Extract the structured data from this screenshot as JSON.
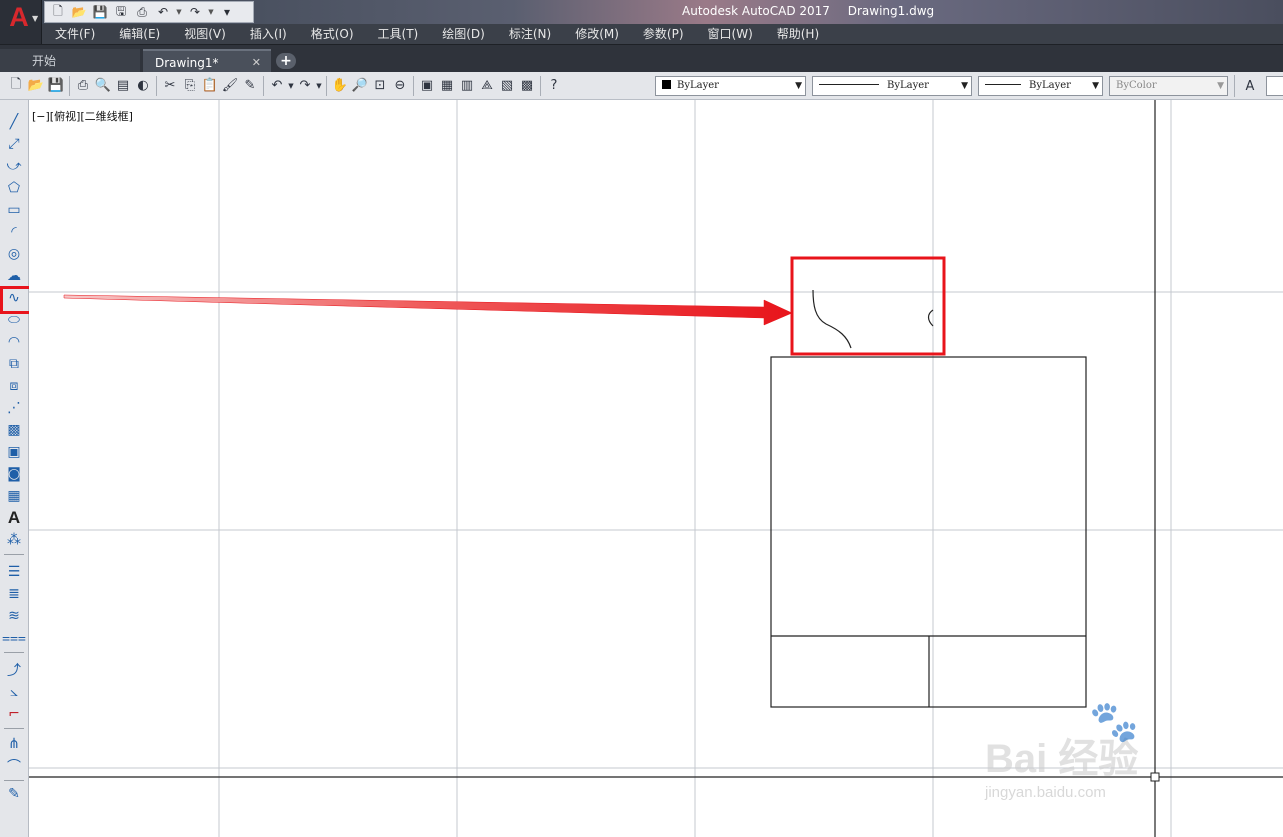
{
  "window": {
    "title_app": "Autodesk AutoCAD 2017",
    "title_file": "Drawing1.dwg",
    "app_logo": "A"
  },
  "menu": [
    "文件(F)",
    "编辑(E)",
    "视图(V)",
    "插入(I)",
    "格式(O)",
    "工具(T)",
    "绘图(D)",
    "标注(N)",
    "修改(M)",
    "参数(P)",
    "窗口(W)",
    "帮助(H)"
  ],
  "tabs": {
    "start": "开始",
    "drawing": "Drawing1*",
    "close": "✕",
    "new": "+"
  },
  "properties": {
    "layer_color": "ByLayer",
    "linetype": "ByLayer",
    "lineweight": "ByLayer",
    "plot_style": "ByColor"
  },
  "viewport": {
    "label": "[−][俯视][二维线框]"
  },
  "watermark": {
    "brand": "Bai 经验",
    "url": "jingyan.baidu.com"
  },
  "colors": {
    "highlight_red": "#e8141b",
    "accent_blue": "#1f5fa8"
  }
}
